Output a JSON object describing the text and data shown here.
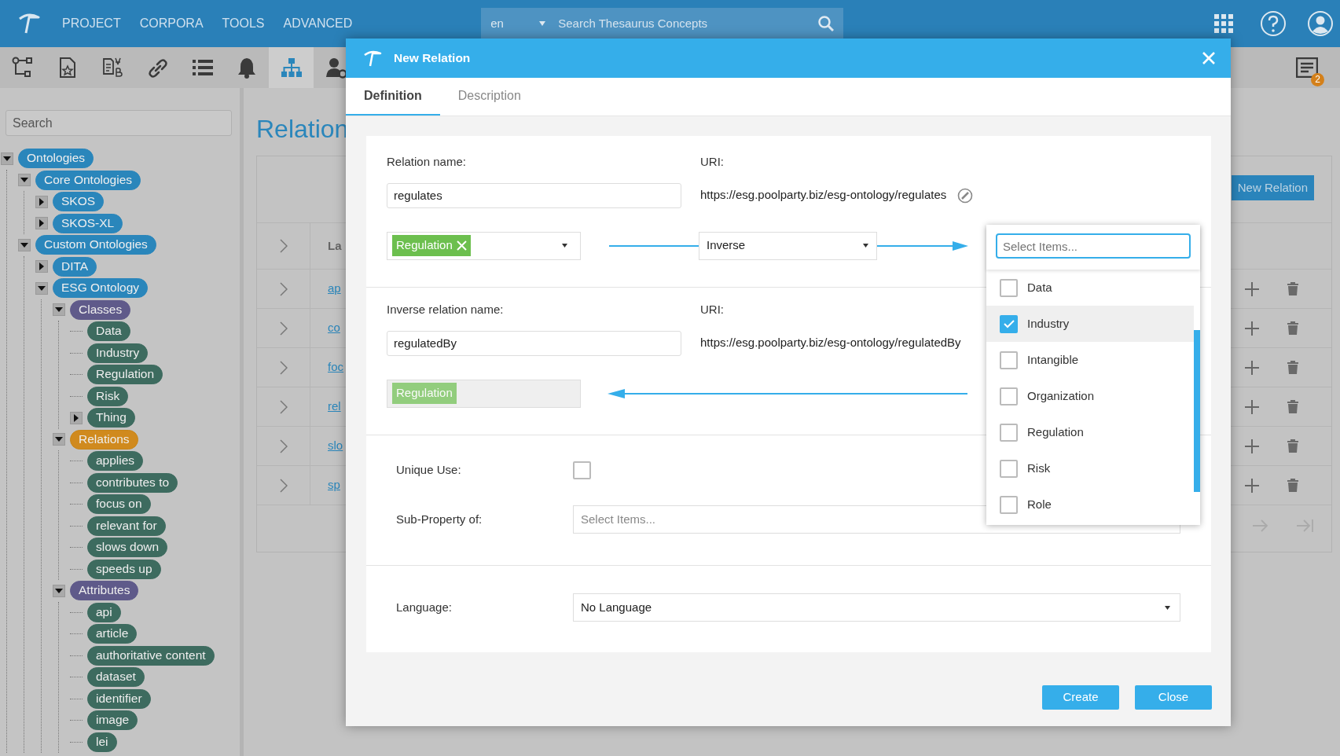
{
  "app_bar": {
    "menu": [
      "PROJECT",
      "CORPORA",
      "TOOLS",
      "ADVANCED"
    ],
    "language": "en",
    "search": {
      "placeholder": "Search Thesaurus Concepts"
    }
  },
  "toolbar": {
    "tools": [
      {
        "selected": false
      },
      {
        "selected": false
      },
      {
        "selected": false
      },
      {
        "selected": false
      },
      {
        "selected": false
      },
      {
        "selected": false
      },
      {
        "selected": true
      },
      {
        "selected": false
      }
    ],
    "notification_count": "2"
  },
  "sidebar": {
    "search": {
      "placeholder": "Search"
    },
    "tree": [
      {
        "label": "Ontologies",
        "kind": "group",
        "expanded": true,
        "selected": false,
        "children": [
          {
            "label": "Core Ontologies",
            "kind": "group",
            "expanded": true,
            "selected": false,
            "children": [
              {
                "label": "SKOS",
                "kind": "group",
                "expanded": false,
                "selected": false
              },
              {
                "label": "SKOS-XL",
                "kind": "group",
                "expanded": false,
                "selected": false
              }
            ]
          },
          {
            "label": "Custom Ontologies",
            "kind": "group",
            "expanded": true,
            "selected": false,
            "children": [
              {
                "label": "DITA",
                "kind": "group",
                "expanded": false,
                "selected": false
              },
              {
                "label": "ESG Ontology",
                "kind": "group",
                "expanded": true,
                "selected": false,
                "children": [
                  {
                    "label": "Classes",
                    "kind": "category",
                    "expanded": true,
                    "selected": false,
                    "children": [
                      {
                        "label": "Data",
                        "kind": "leaf",
                        "selected": false
                      },
                      {
                        "label": "Industry",
                        "kind": "leaf",
                        "selected": false
                      },
                      {
                        "label": "Regulation",
                        "kind": "leaf",
                        "selected": false
                      },
                      {
                        "label": "Risk",
                        "kind": "leaf",
                        "selected": false
                      },
                      {
                        "label": "Thing",
                        "kind": "leaf",
                        "expanded": false,
                        "selected": false
                      }
                    ]
                  },
                  {
                    "label": "Relations",
                    "kind": "category",
                    "expanded": true,
                    "selected": true,
                    "children": [
                      {
                        "label": "applies",
                        "kind": "leaf",
                        "selected": false
                      },
                      {
                        "label": "contributes to",
                        "kind": "leaf",
                        "selected": false
                      },
                      {
                        "label": "focus on",
                        "kind": "leaf",
                        "selected": false
                      },
                      {
                        "label": "relevant for",
                        "kind": "leaf",
                        "selected": false
                      },
                      {
                        "label": "slows down",
                        "kind": "leaf",
                        "selected": false
                      },
                      {
                        "label": "speeds up",
                        "kind": "leaf",
                        "selected": false
                      }
                    ]
                  },
                  {
                    "label": "Attributes",
                    "kind": "category",
                    "expanded": true,
                    "selected": false,
                    "children": [
                      {
                        "label": "api",
                        "kind": "leaf",
                        "selected": false
                      },
                      {
                        "label": "article",
                        "kind": "leaf",
                        "selected": false
                      },
                      {
                        "label": "authoritative content",
                        "kind": "leaf",
                        "selected": false
                      },
                      {
                        "label": "dataset",
                        "kind": "leaf",
                        "selected": false
                      },
                      {
                        "label": "identifier",
                        "kind": "leaf",
                        "selected": false
                      },
                      {
                        "label": "image",
                        "kind": "leaf",
                        "selected": false
                      },
                      {
                        "label": "lei",
                        "kind": "leaf",
                        "selected": false
                      }
                    ]
                  }
                ]
              }
            ]
          }
        ]
      }
    ]
  },
  "main": {
    "title": "Relation",
    "new_button": "New Relation",
    "table": {
      "header": "La",
      "rows": [
        {
          "label": "ap"
        },
        {
          "label": "co"
        },
        {
          "label": "foc"
        },
        {
          "label": "rel"
        },
        {
          "label": "slo"
        },
        {
          "label": "sp"
        }
      ]
    }
  },
  "dialog": {
    "title": "New Relation",
    "tabs": [
      {
        "label": "Definition",
        "selected": true
      },
      {
        "label": "Description",
        "selected": false
      }
    ],
    "relation_name": {
      "label": "Relation name:",
      "value": "regulates"
    },
    "uri": {
      "label": "URI:",
      "value": "https://esg.poolparty.biz/esg-ontology/regulates"
    },
    "domain": {
      "tags": [
        "Regulation"
      ],
      "disabled": false
    },
    "relation_type": {
      "value": "Inverse"
    },
    "range_dropdown": {
      "placeholder": "Select Items...",
      "options": [
        {
          "label": "Data",
          "checked": false
        },
        {
          "label": "Industry",
          "checked": true
        },
        {
          "label": "Intangible",
          "checked": false
        },
        {
          "label": "Organization",
          "checked": false
        },
        {
          "label": "Regulation",
          "checked": false
        },
        {
          "label": "Risk",
          "checked": false
        },
        {
          "label": "Role",
          "checked": false
        }
      ]
    },
    "inverse_name": {
      "label": "Inverse relation name:",
      "value": "regulatedBy"
    },
    "inverse_uri": {
      "label": "URI:",
      "value": "https://esg.poolparty.biz/esg-ontology/regulatedBy"
    },
    "inverse_range": {
      "tags": [
        "Regulation"
      ],
      "disabled": true
    },
    "unique_use": {
      "label": "Unique Use:",
      "checked": false
    },
    "sub_property": {
      "label": "Sub-Property of:",
      "placeholder": "Select Items..."
    },
    "language": {
      "label": "Language:",
      "value": "No Language"
    },
    "buttons": [
      "Create",
      "Close"
    ]
  }
}
